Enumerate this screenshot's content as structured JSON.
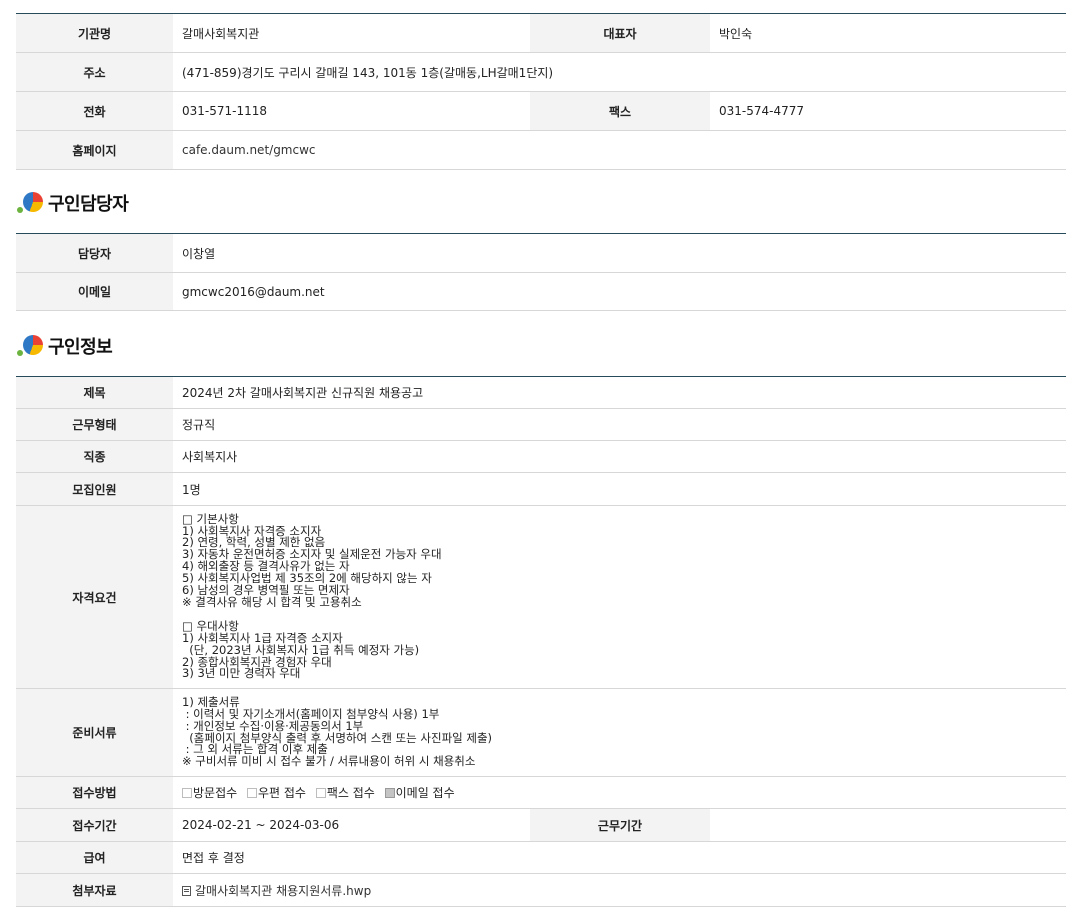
{
  "org": {
    "name_label": "기관명",
    "name": "갈매사회복지관",
    "rep_label": "대표자",
    "rep": "박인숙",
    "addr_label": "주소",
    "addr": "(471-859)경기도 구리시 갈매길 143, 101동 1층(갈매동,LH갈매1단지)",
    "phone_label": "전화",
    "phone": "031-571-1118",
    "fax_label": "팩스",
    "fax": "031-574-4777",
    "homepage_label": "홈페이지",
    "homepage": "cafe.daum.net/gmcwc"
  },
  "contact": {
    "title": "구인담당자",
    "manager_label": "담당자",
    "manager": "이창열",
    "email_label": "이메일",
    "email": "gmcwc2016@daum.net"
  },
  "job": {
    "title": "구인정보",
    "subject_label": "제목",
    "subject": "2024년 2차 갈매사회복지관 신규직원 채용공고",
    "worktype_label": "근무형태",
    "worktype": "정규직",
    "category_label": "직종",
    "category": "사회복지사",
    "headcount_label": "모집인원",
    "headcount": "1명",
    "qual_label": "자격요건",
    "qual": "□ 기본사항\n1) 사회복지사 자격증 소지자\n2) 연령, 학력, 성별 제한 없음\n3) 자동차 운전면허증 소지자 및 실제운전 가능자 우대\n4) 해외출장 등 결격사유가 없는 자\n5) 사회복지사업법 제 35조의 2에 해당하지 않는 자\n6) 남성의 경우 병역필 또는 면제자\n※ 결격사유 해당 시 합격 및 고용취소\n\n□ 우대사항\n1) 사회복지사 1급 자격증 소지자\n  (단, 2023년 사회복지사 1급 취득 예정자 가능)\n2) 종합사회복지관 경험자 우대\n3) 3년 미만 경력자 우대",
    "docs_label": "준비서류",
    "docs": "1) 제출서류\n : 이력서 및 자기소개서(홈페이지 첨부양식 사용) 1부\n : 개인정보 수집·이용·제공동의서 1부\n  (홈페이지 첨부양식 출력 후 서명하여 스캔 또는 사진파일 제출)\n : 그 외 서류는 합격 이후 제출\n※ 구비서류 미비 시 접수 불가 / 서류내용이 허위 시 채용취소",
    "method_label": "접수방법",
    "methods": [
      {
        "label": "방문접수",
        "checked": false
      },
      {
        "label": "우편 접수",
        "checked": false
      },
      {
        "label": "팩스 접수",
        "checked": false
      },
      {
        "label": "이메일 접수",
        "checked": true
      }
    ],
    "period_label": "접수기간",
    "period": "2024-02-21 ~ 2024-03-06",
    "workperiod_label": "근무기간",
    "workperiod": "",
    "salary_label": "급여",
    "salary": "면접 후 결정",
    "attach_label": "첨부자료",
    "attach": "갈매사회복지관 채용지원서류.hwp"
  }
}
